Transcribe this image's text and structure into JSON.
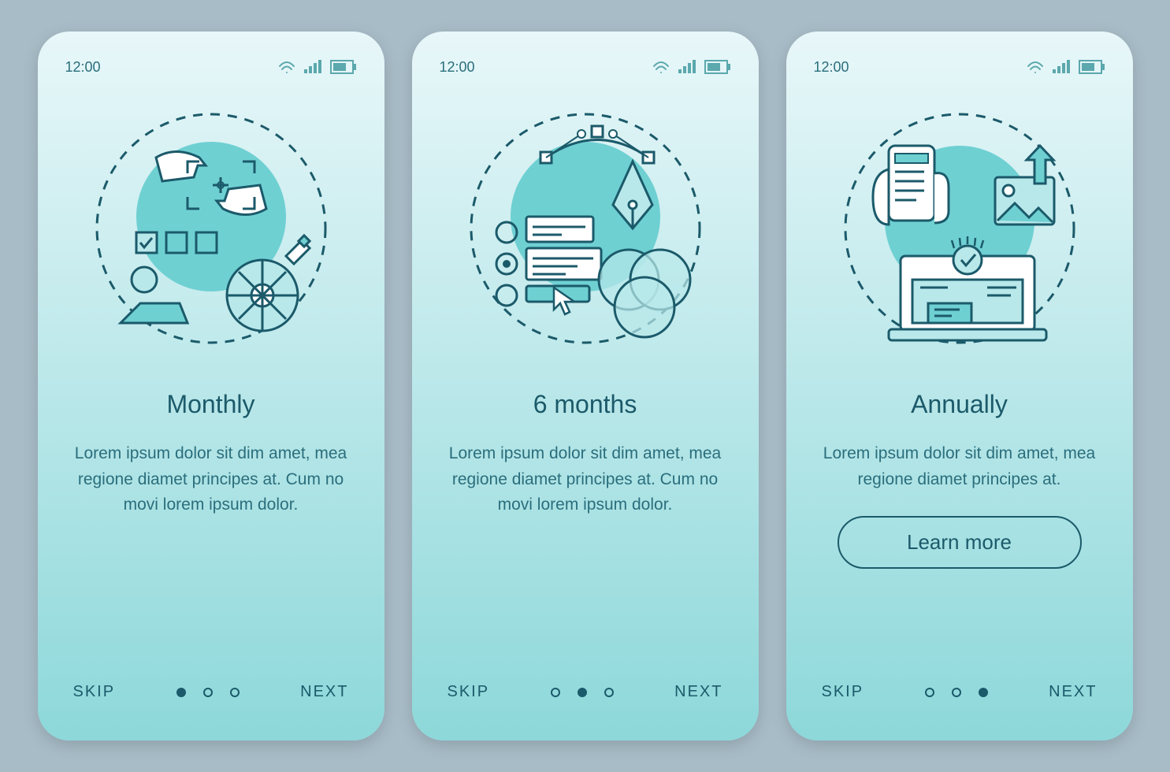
{
  "status": {
    "time": "12:00"
  },
  "screens": [
    {
      "title": "Monthly",
      "description": "Lorem ipsum dolor sit dim amet, mea regione diamet principes at. Cum no movi lorem ipsum dolor.",
      "skip_label": "SKIP",
      "next_label": "NEXT",
      "active_dot": 0,
      "has_cta": false
    },
    {
      "title": "6 months",
      "description": "Lorem ipsum dolor sit dim amet, mea regione diamet principes at. Cum no movi lorem ipsum dolor.",
      "skip_label": "SKIP",
      "next_label": "NEXT",
      "active_dot": 1,
      "has_cta": false
    },
    {
      "title": "Annually",
      "description": "Lorem ipsum dolor sit dim amet, mea regione diamet principes at.",
      "skip_label": "SKIP",
      "next_label": "NEXT",
      "active_dot": 2,
      "has_cta": true,
      "cta_label": "Learn more"
    }
  ],
  "colors": {
    "stroke": "#1b5a6a",
    "accent": "#6fd0d2",
    "fill": "#b8e8ea"
  }
}
